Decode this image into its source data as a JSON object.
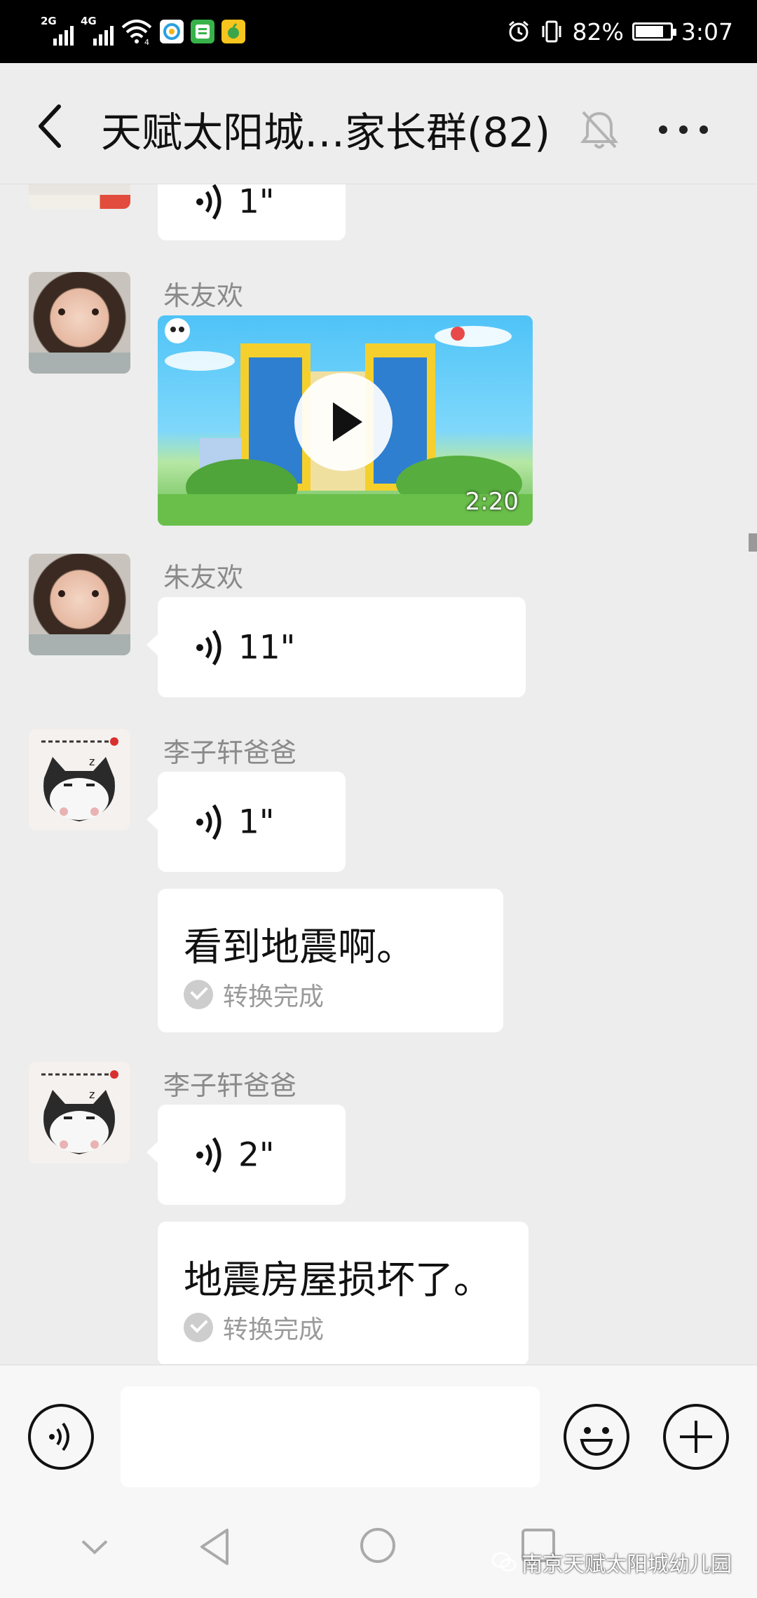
{
  "status_bar": {
    "net1": "2G",
    "net2": "4G",
    "wifi_label": "4",
    "battery": "82%",
    "battery_level": 0.82,
    "time": "3:07"
  },
  "header": {
    "title": "天赋太阳城…家长群(82)"
  },
  "messages": [
    {
      "kind": "voice",
      "duration": "1\""
    },
    {
      "kind": "video",
      "sender": "朱友欢",
      "duration": "2:20"
    },
    {
      "kind": "voice",
      "sender": "朱友欢",
      "duration": "11\""
    },
    {
      "kind": "voice",
      "sender": "李子轩爸爸",
      "duration": "1\"",
      "transcript": "看到地震啊。",
      "transcript_status": "转换完成"
    },
    {
      "kind": "voice",
      "sender": "李子轩爸爸",
      "duration": "2\"",
      "transcript": "地震房屋损坏了。",
      "transcript_status": "转换完成"
    }
  ],
  "input": {
    "placeholder": ""
  },
  "watermark": "南京天赋太阳城幼儿园",
  "colors": {
    "chat_bg": "#ededed",
    "bubble": "#ffffff",
    "sender_name": "#8a8a8a"
  },
  "icons": [
    "back-icon",
    "bell-muted-icon",
    "more-icon",
    "voice-wave-icon",
    "play-icon",
    "check-icon",
    "voice-input-icon",
    "emoji-icon",
    "plus-icon",
    "nav-back-icon",
    "nav-home-icon",
    "nav-recents-icon",
    "nav-collapse-icon"
  ]
}
